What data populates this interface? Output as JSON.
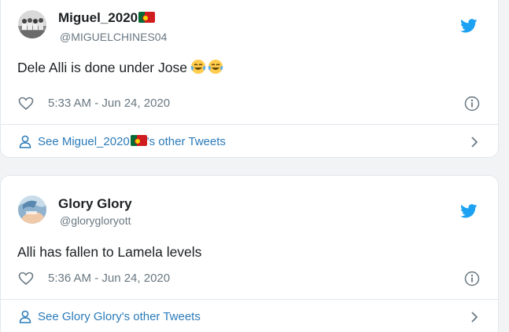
{
  "tweets": [
    {
      "display_name": "Miguel_2020",
      "handle": "@MIGUELCHINES04",
      "text": "Dele Alli is done under Jose",
      "time": "5:33 AM - Jun 24, 2020",
      "see_prefix": "See Miguel_2020",
      "see_suffix": "'s other Tweets",
      "flag_icon": "portugal-flag-icon",
      "emojis": [
        "face-with-tears-of-joy-icon",
        "face-with-tears-of-joy-icon"
      ]
    },
    {
      "display_name": "Glory Glory",
      "handle": "@glorygloryott",
      "text": "Alli has fallen to Lamela levels",
      "time": "5:36 AM - Jun 24, 2020",
      "see_prefix": "See Glory Glory's other Tweets",
      "see_suffix": ""
    }
  ],
  "colors": {
    "twitter_blue": "#1da1f2",
    "link_blue": "#2b7bb9",
    "muted": "#697882",
    "border": "#e1e8ed"
  }
}
